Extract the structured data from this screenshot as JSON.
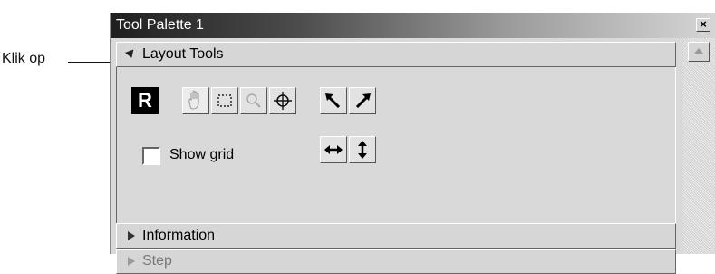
{
  "callout": {
    "text": "Klik op"
  },
  "window": {
    "title": "Tool Palette 1",
    "close_glyph": "×"
  },
  "sections": {
    "layout_tools": {
      "label": "Layout Tools",
      "expanded": true
    },
    "information": {
      "label": "Information",
      "expanded": false
    },
    "step": {
      "label": "Step",
      "expanded": false
    }
  },
  "tools": {
    "r_label": "R",
    "icons": [
      "r-tool-icon",
      "hand-tool-icon",
      "select-rect-icon",
      "zoom-icon",
      "crosshair-icon",
      "rotate-left-icon",
      "rotate-right-icon",
      "flip-horizontal-icon",
      "flip-vertical-icon"
    ]
  },
  "show_grid": {
    "label": "Show grid",
    "checked": false
  }
}
